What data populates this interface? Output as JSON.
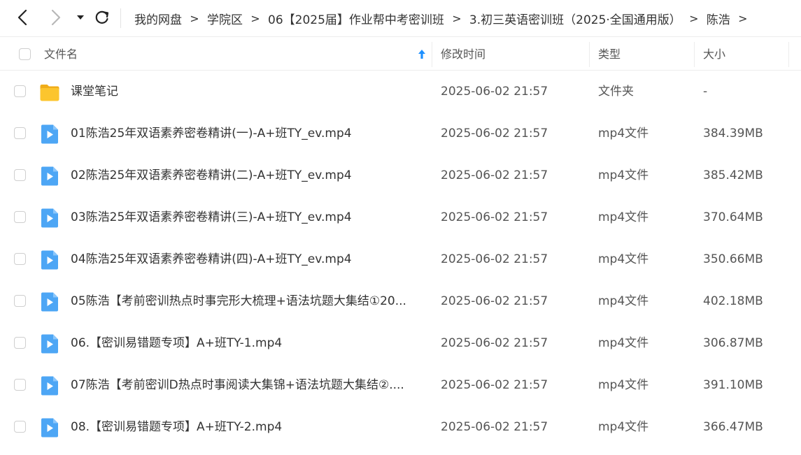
{
  "toolbar": {
    "back_icon": "chevron-left-icon",
    "forward_icon": "chevron-right-icon",
    "history_icon": "caret-down-icon",
    "refresh_icon": "refresh-icon"
  },
  "breadcrumb": [
    "我的网盘",
    "学院区",
    "06【2025届】作业帮中考密训班",
    "3.初三英语密训班（2025·全国通用版）",
    "陈浩"
  ],
  "breadcrumb_separator": ">",
  "columns": {
    "name": "文件名",
    "modified": "修改时间",
    "type": "类型",
    "size": "大小"
  },
  "sort_icon": "sort-ascending-arrow-icon",
  "files": [
    {
      "name": "课堂笔记",
      "modified": "2025-06-02 21:57",
      "type": "文件夹",
      "size": "-",
      "icon": "folder-icon"
    },
    {
      "name": "01陈浩25年双语素养密卷精讲(一)-A+班TY_ev.mp4",
      "modified": "2025-06-02 21:57",
      "type": "mp4文件",
      "size": "384.39MB",
      "icon": "video-file-icon"
    },
    {
      "name": "02陈浩25年双语素养密卷精讲(二)-A+班TY_ev.mp4",
      "modified": "2025-06-02 21:57",
      "type": "mp4文件",
      "size": "385.42MB",
      "icon": "video-file-icon"
    },
    {
      "name": "03陈浩25年双语素养密卷精讲(三)-A+班TY_ev.mp4",
      "modified": "2025-06-02 21:57",
      "type": "mp4文件",
      "size": "370.64MB",
      "icon": "video-file-icon"
    },
    {
      "name": "04陈浩25年双语素养密卷精讲(四)-A+班TY_ev.mp4",
      "modified": "2025-06-02 21:57",
      "type": "mp4文件",
      "size": "350.66MB",
      "icon": "video-file-icon"
    },
    {
      "name": "05陈浩【考前密训热点时事完形大梳理+语法坑题大集结①20...",
      "modified": "2025-06-02 21:57",
      "type": "mp4文件",
      "size": "402.18MB",
      "icon": "video-file-icon"
    },
    {
      "name": "06.【密训易错题专项】A+班TY-1.mp4",
      "modified": "2025-06-02 21:57",
      "type": "mp4文件",
      "size": "306.87MB",
      "icon": "video-file-icon"
    },
    {
      "name": "07陈浩【考前密训D热点时事阅读大集锦+语法坑题大集结②....",
      "modified": "2025-06-02 21:57",
      "type": "mp4文件",
      "size": "391.10MB",
      "icon": "video-file-icon"
    },
    {
      "name": "08.【密训易错题专项】A+班TY-2.mp4",
      "modified": "2025-06-02 21:57",
      "type": "mp4文件",
      "size": "366.47MB",
      "icon": "video-file-icon"
    }
  ],
  "colors": {
    "accent": "#1e90ff",
    "folder": "#fcc52e",
    "video": "#4da6f5"
  }
}
